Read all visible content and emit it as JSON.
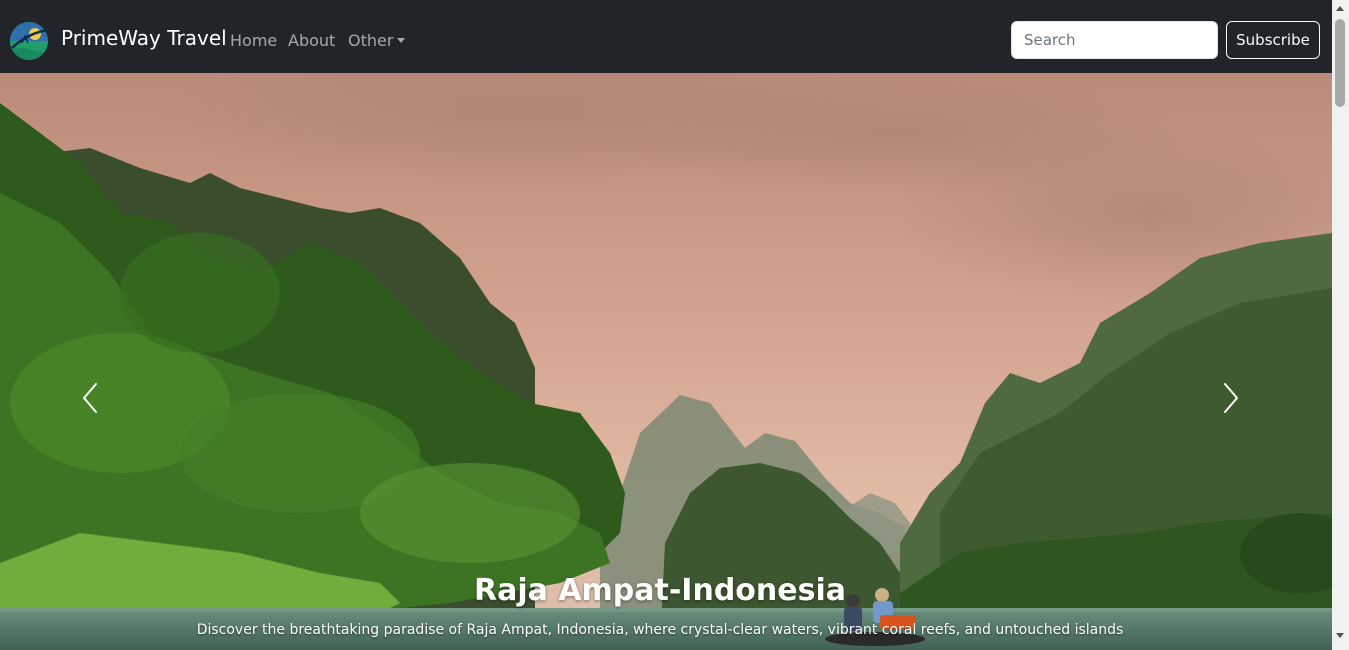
{
  "navbar": {
    "brand": "PrimeWay Travel",
    "links": [
      {
        "label": "Home"
      },
      {
        "label": "About"
      },
      {
        "label": "Other"
      }
    ],
    "search": {
      "placeholder": "Search",
      "value": ""
    },
    "subscribe_label": "Subscribe"
  },
  "carousel": {
    "title": "Raja Ampat-Indonesia",
    "text": "Discover the breathtaking paradise of Raja Ampat, Indonesia, where crystal-clear waters, vibrant coral reefs, and untouched islands"
  },
  "icons": {
    "logo": "globe-logo-icon",
    "prev": "chevron-left-icon",
    "next": "chevron-right-icon",
    "dropdown": "caret-down-icon"
  },
  "colors": {
    "navbar_bg": "#212529",
    "nav_link": "rgba(255,255,255,0.6)",
    "sky": "#c99e87",
    "foliage": "#2f5b1e"
  }
}
